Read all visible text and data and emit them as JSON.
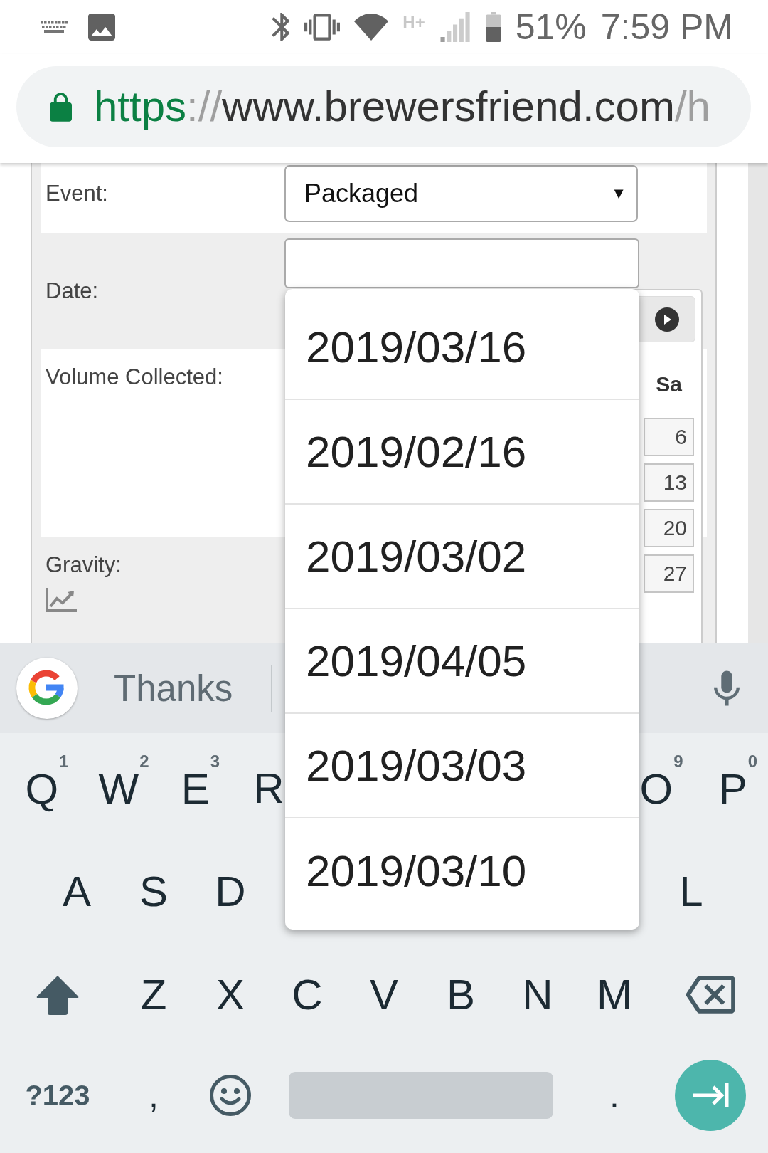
{
  "status_bar": {
    "network_type": "H+",
    "battery": "51%",
    "time": "7:59 PM"
  },
  "address_bar": {
    "url": {
      "scheme": "https",
      "separator": "://",
      "host": "www.brewersfriend.com",
      "path": "/h"
    }
  },
  "form": {
    "rows": [
      {
        "kind": "select",
        "label": "Event:",
        "value": "Packaged",
        "arrow": "▼"
      },
      {
        "kind": "date",
        "label": "Date:"
      },
      {
        "kind": "blank",
        "label": "Volume Collected:"
      },
      {
        "kind": "chart",
        "label": "Gravity:"
      }
    ]
  },
  "date_picker": {
    "weekday": "Sa",
    "days": [
      "6",
      "13",
      "20",
      "27"
    ]
  },
  "date_menu": {
    "options": [
      {
        "label": "2019/03/16",
        "selected": false
      },
      {
        "label": "2019/02/16",
        "selected": false
      },
      {
        "label": "2019/03/02",
        "selected": false
      },
      {
        "label": "2019/04/05",
        "selected": false
      },
      {
        "label": "2019/03/03",
        "selected": false
      },
      {
        "label": "2019/03/10",
        "selected": false
      }
    ]
  },
  "keyboard": {
    "suggestion": "Thanks",
    "rows": [
      {
        "keys": [
          {
            "kind": "letter",
            "label": "Q",
            "hint": "1"
          },
          {
            "kind": "letter",
            "label": "W",
            "hint": "2"
          },
          {
            "kind": "letter",
            "label": "E",
            "hint": "3"
          },
          {
            "kind": "letter",
            "label": "R"
          }
        ],
        "keys_right": [
          {
            "kind": "letter",
            "label": "O",
            "hint": "9"
          },
          {
            "kind": "letter",
            "label": "P",
            "hint": "0"
          }
        ]
      },
      {
        "keys": [
          {
            "kind": "letter",
            "label": "A"
          },
          {
            "kind": "letter",
            "label": "S"
          },
          {
            "kind": "letter",
            "label": "D"
          }
        ],
        "keys_right": [
          {
            "kind": "letter",
            "label": "L"
          }
        ]
      },
      {
        "keys": [
          {
            "kind": "shift"
          },
          {
            "kind": "letter",
            "label": "Z"
          },
          {
            "kind": "letter",
            "label": "X"
          },
          {
            "kind": "letter",
            "label": "C"
          },
          {
            "kind": "letter",
            "label": "V"
          },
          {
            "kind": "letter",
            "label": "B"
          },
          {
            "kind": "letter",
            "label": "N"
          },
          {
            "kind": "letter",
            "label": "M"
          },
          {
            "kind": "backspace"
          }
        ]
      },
      {
        "keys": [
          {
            "kind": "symbols",
            "label": "?123"
          },
          {
            "kind": "punct",
            "label": ","
          },
          {
            "kind": "emoji"
          },
          {
            "kind": "space"
          },
          {
            "kind": "punct",
            "label": "."
          },
          {
            "kind": "enter"
          }
        ]
      }
    ]
  }
}
